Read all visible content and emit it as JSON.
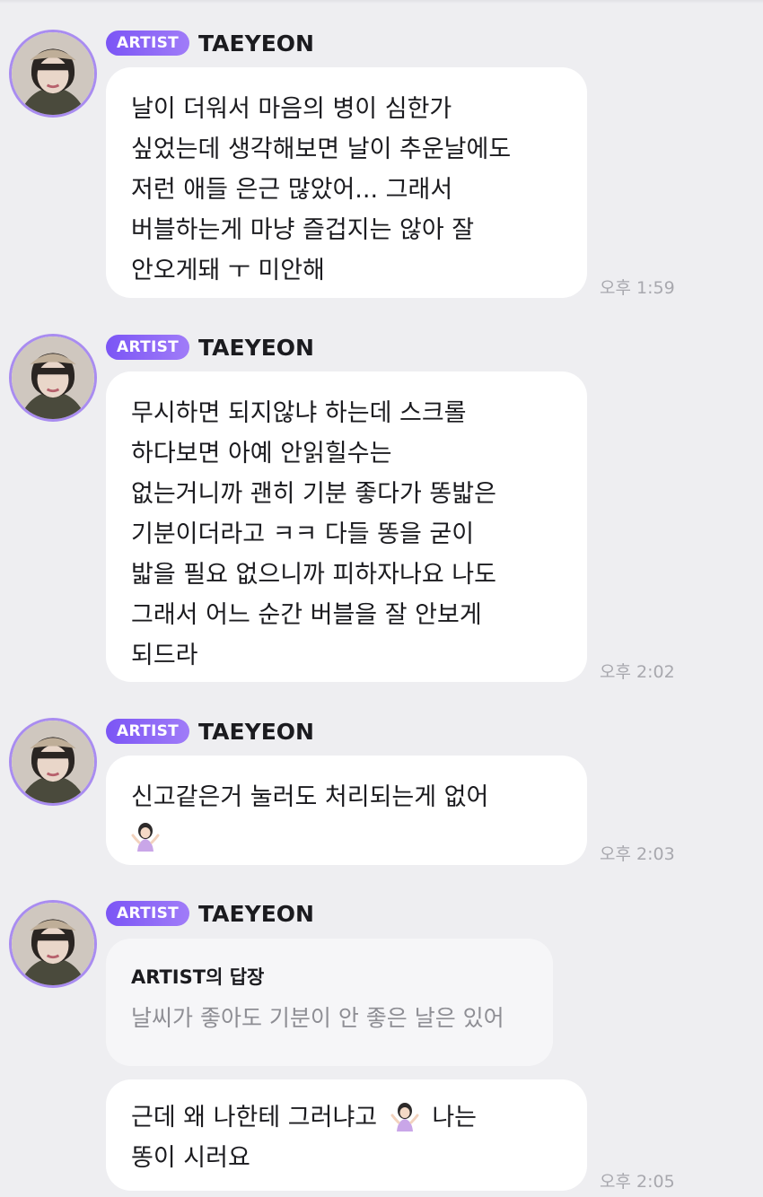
{
  "chat": {
    "messages": [
      {
        "badge": "ARTIST",
        "sender": "TAEYEON",
        "lines": [
          "날이 더워서 마음의 병이 심한가",
          "싶었는데 생각해보면 날이 추운날에도",
          "저런 애들 은근 많았어... 그래서",
          "버블하는게 마냥 즐겁지는 않아 잘",
          "안오게돼 ㅜ 미안해"
        ],
        "time": "오후 1:59"
      },
      {
        "badge": "ARTIST",
        "sender": "TAEYEON",
        "lines": [
          "무시하면 되지않냐 하는데 스크롤",
          "하다보면 아예 안읽힐수는",
          "없는거니까 괜히 기분 좋다가 똥밟은",
          "기분이더라고 ㅋㅋ 다들 똥을 굳이",
          "밟을 필요 없으니까 피하자나요 나도",
          "그래서 어느 순간 버블을 잘 안보게",
          "되드라"
        ],
        "time": "오후 2:02"
      },
      {
        "badge": "ARTIST",
        "sender": "TAEYEON",
        "lines": [
          "신고같은거 눌러도 처리되는게 없어"
        ],
        "emoji": "person-shrugging-emoji",
        "time": "오후 2:03"
      },
      {
        "badge": "ARTIST",
        "sender": "TAEYEON",
        "reply": {
          "title": "ARTIST의 답장",
          "quote": "날씨가 좋아도 기분이 안 좋은 날은 있어"
        },
        "lines": [
          "근데 왜 나한테 그러냐고",
          "나는",
          "똥이 시러요"
        ],
        "emoji": "person-shrugging-emoji",
        "time": "오후 2:05"
      }
    ]
  },
  "colors": {
    "background": "#eeeef1",
    "bubble": "#ffffff",
    "reply_bubble": "#f6f6f8",
    "badge_start": "#7b55f5",
    "badge_end": "#a07cf8",
    "avatar_ring": "#a98cf0",
    "timestamp": "#a8a8ae",
    "text": "#1b1b1f",
    "reply_quote": "#8e8e94"
  }
}
